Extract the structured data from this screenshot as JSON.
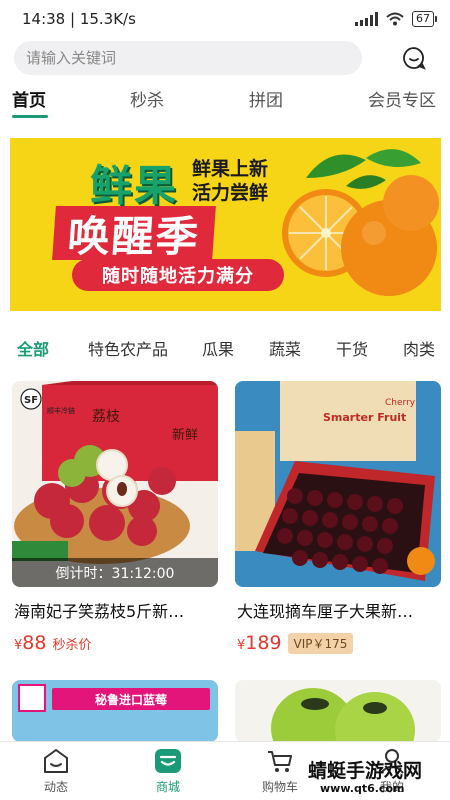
{
  "status_bar": {
    "time_speed": "14:38 | 15.3K/s",
    "battery": "67"
  },
  "search": {
    "placeholder": "请输入关键词"
  },
  "top_tabs": [
    "首页",
    "秒杀",
    "拼团",
    "会员专区"
  ],
  "banner": {
    "headline": "鲜果",
    "sub_line1": "鲜果上新",
    "sub_line2": "活力尝鲜",
    "wake_text": "唤醒季",
    "slogan": "随时随地活力满分"
  },
  "category_tabs": [
    "全部",
    "特色农产品",
    "瓜果",
    "蔬菜",
    "干货",
    "肉类"
  ],
  "products": [
    {
      "title": "海南妃子笑荔枝5斤新…",
      "price_symbol": "¥",
      "price": "88",
      "tag": "秒杀价",
      "countdown": "倒计时：31:12:00",
      "image_text": {
        "logo": "SF",
        "brand": "顺丰冷链",
        "box_text": "荔枝",
        "fresh": "新鲜"
      }
    },
    {
      "title": "大连现摘车厘子大果新…",
      "price_symbol": "¥",
      "price": "189",
      "vip": "VIP￥175",
      "image_text": {
        "box_title": "Smarter Fruit",
        "cherry": "Cherry"
      }
    }
  ],
  "second_row": [
    {
      "image_text": "秘鲁进口蓝莓"
    },
    {
      "image_text": ""
    }
  ],
  "bottom_nav": [
    "动态",
    "商城",
    "购物车",
    "我的"
  ],
  "watermark": {
    "text": "蜻蜓手游戏网",
    "url": "www.qt6.com"
  },
  "colors": {
    "accent": "#1a9a76",
    "price": "#e03a2a",
    "banner_bg": "#f5d515",
    "banner_red": "#e0293b"
  }
}
